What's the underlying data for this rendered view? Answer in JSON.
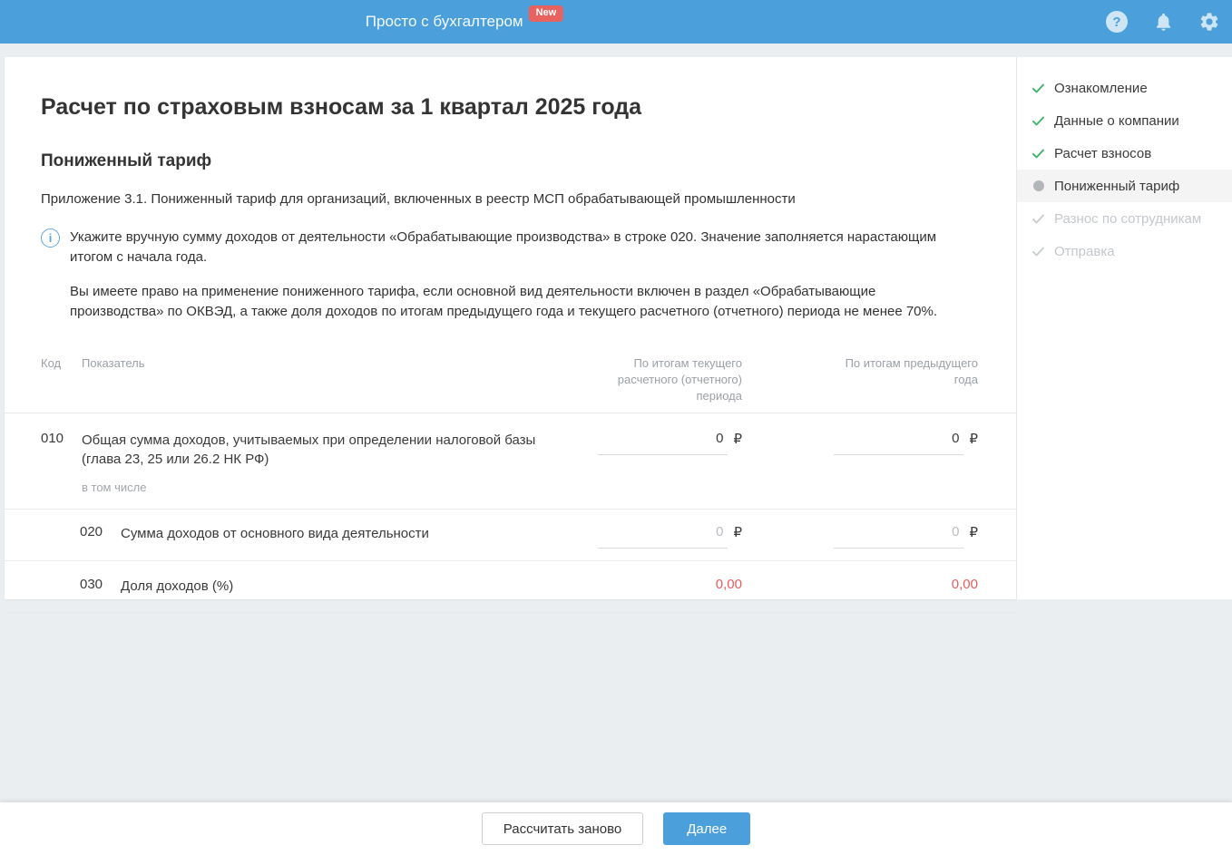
{
  "header": {
    "app_title": "Просто с бухгалтером",
    "badge": "New"
  },
  "page": {
    "title": "Расчет по страховым взносам за 1 квартал 2025 года",
    "section_title": "Пониженный тариф",
    "appendix": "Приложение 3.1. Пониженный тариф для организаций, включенных в реестр МСП обрабатывающей промышленности",
    "info": {
      "paragraph1": "Укажите вручную сумму доходов от деятельности «Обрабатывающие производства» в строке 020. Значение заполняется нарастающим итогом с начала года.",
      "paragraph2": "Вы имеете право на применение пониженного тарифа, если основной вид деятельности включен в раздел «Обрабатывающие производства» по ОКВЭД, а также доля доходов по итогам предыдущего года и текущего расчетного (отчетного) периода не менее 70%."
    }
  },
  "table": {
    "currency": "₽",
    "headers": {
      "code": "Код",
      "indicator": "Показатель",
      "current_period": "По итогам текущего расчетного (отчетного) периода",
      "previous_year": "По итогам предыдущего года"
    },
    "rows": [
      {
        "code": "010",
        "label": "Общая сумма доходов, учитываемых при определении налоговой базы (глава 23, 25 или 26.2 НК РФ)",
        "note": "в том числе",
        "current_value": "0",
        "previous_value": "0"
      },
      {
        "code": "020",
        "label": "Сумма доходов от основного вида деятельности",
        "current_value": "0",
        "previous_value": "0"
      },
      {
        "code": "030",
        "label": "Доля доходов (%)",
        "current_value": "0,00",
        "previous_value": "0,00"
      }
    ]
  },
  "sidebar": {
    "steps": [
      {
        "label": "Ознакомление",
        "status": "done"
      },
      {
        "label": "Данные о компании",
        "status": "done"
      },
      {
        "label": "Расчет взносов",
        "status": "done"
      },
      {
        "label": "Пониженный тариф",
        "status": "active"
      },
      {
        "label": "Разнос по сотрудникам",
        "status": "pending"
      },
      {
        "label": "Отправка",
        "status": "pending"
      }
    ]
  },
  "footer": {
    "recalculate_label": "Рассчитать заново",
    "next_label": "Далее"
  },
  "colors": {
    "header_blue": "#4ba0dc",
    "badge_red": "#e8625f",
    "success_green": "#3cb46a",
    "error_red": "#e85d5d",
    "page_background": "#ebeef0",
    "active_step_background": "#f4f4f4"
  }
}
